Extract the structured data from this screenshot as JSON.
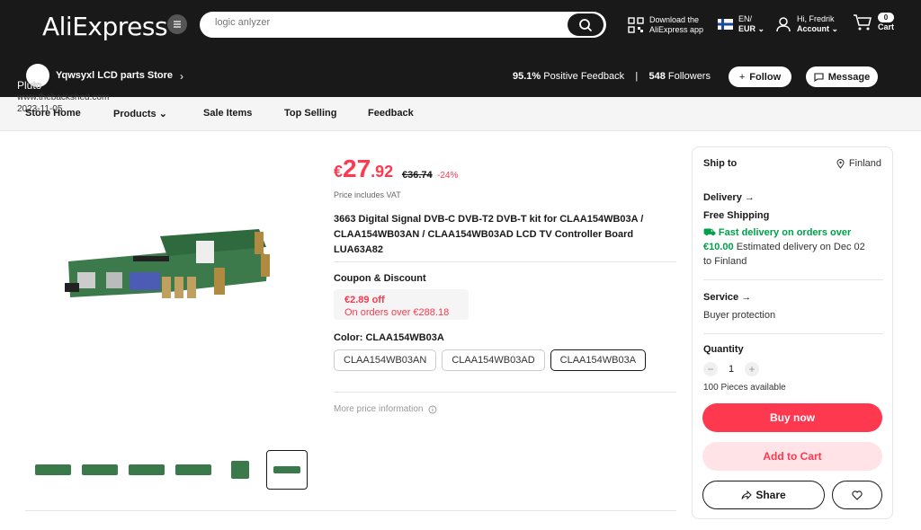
{
  "header": {
    "logo": "AliExpress",
    "search_placeholder": "logic anlyzer",
    "download_line1": "Download the",
    "download_line2": "AliExpress app",
    "lang": "EN/",
    "currency": "EUR",
    "greeting": "Hi, Fredrik",
    "account": "Account",
    "cart_count": "0",
    "cart_label": "Cart"
  },
  "store": {
    "name": "Yqwsyxl LCD parts Store",
    "feedback_pct": "95.1%",
    "feedback_label": "Positive Feedback",
    "separator": "|",
    "followers_count": "548",
    "followers_label": "Followers",
    "follow_label": "Follow",
    "message_label": "Message"
  },
  "watermark": {
    "title": "Pluto",
    "site": "www.thebackshed.com",
    "date": "2023-11-05"
  },
  "nav": {
    "items": [
      "Store Home",
      "Products",
      "Sale Items",
      "Top Selling",
      "Feedback"
    ]
  },
  "product": {
    "currency": "€",
    "price_int": "27",
    "price_dec": ".92",
    "old_price": "€36.74",
    "discount": "-24%",
    "vat": "Price includes VAT",
    "title": "3663 Digital Signal DVB-C DVB-T2 DVB-T kit for CLAA154WB03A / CLAA154WB03AN / CLAA154WB03AD LCD TV Controller Board LUA63A82",
    "coupon_title": "Coupon & Discount",
    "coupon_value": "€2.89 off",
    "coupon_condition": "On orders over €288.18",
    "color_label": "Color: CLAA154WB03A",
    "variants": [
      "CLAA154WB03AN",
      "CLAA154WB03AD",
      "CLAA154WB03A"
    ],
    "more_price": "More price information"
  },
  "side": {
    "ship_to": "Ship to",
    "country": "Finland",
    "delivery": "Delivery",
    "free_shipping": "Free Shipping",
    "fast_delivery": "Fast delivery on orders over",
    "fast_amount": "€10.00",
    "estimated": "Estimated delivery on Dec 02",
    "to_finland": "to Finland",
    "service": "Service",
    "buyer_protection": "Buyer protection",
    "quantity": "Quantity",
    "qty_value": "1",
    "qty_minus": "−",
    "qty_plus": "+",
    "available": "100 Pieces available",
    "buy_now": "Buy now",
    "add_to_cart": "Add to Cart",
    "share": "Share"
  }
}
